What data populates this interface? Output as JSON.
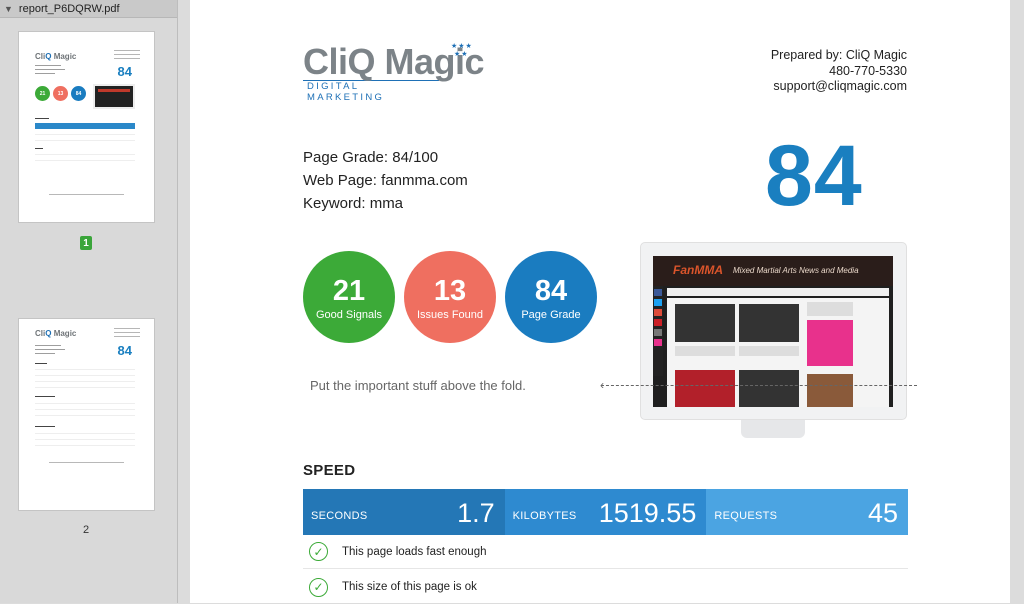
{
  "sidebar": {
    "file_name": "report_P6DQRW.pdf",
    "pages": [
      {
        "number": "1",
        "selected": true,
        "score": "84"
      },
      {
        "number": "2",
        "selected": false,
        "score": "84"
      }
    ]
  },
  "report": {
    "logo": {
      "name": "CliQ Magic",
      "tagline": "DIGITAL MARKETING"
    },
    "contact": {
      "prepared_by": "Prepared by: CliQ Magic",
      "phone": "480-770-5330",
      "email": "support@cliqmagic.com"
    },
    "page_grade_line": "Page Grade: 84/100",
    "web_page_line": "Web Page: fanmma.com",
    "keyword_line": "Keyword: mma",
    "big_score": "84",
    "circles": [
      {
        "value": "21",
        "label": "Good Signals",
        "color": "#3caa38"
      },
      {
        "value": "13",
        "label": "Issues Found",
        "color": "#ef6f60"
      },
      {
        "value": "84",
        "label": "Page Grade",
        "color": "#1a7cc0"
      }
    ],
    "fold_note": "Put the important stuff above the fold.",
    "screenshot": {
      "site_title": "FanMMA",
      "site_tagline": "Mixed Martial Arts News and Media"
    },
    "speed": {
      "title": "SPEED",
      "metrics": [
        {
          "label": "SECONDS",
          "value": "1.7"
        },
        {
          "label": "KILOBYTES",
          "value": "1519.55"
        },
        {
          "label": "REQUESTS",
          "value": "45"
        }
      ],
      "checks": [
        {
          "text": "This page loads fast enough",
          "status": "pass"
        },
        {
          "text": "This size of this page is ok",
          "status": "pass"
        }
      ]
    }
  }
}
